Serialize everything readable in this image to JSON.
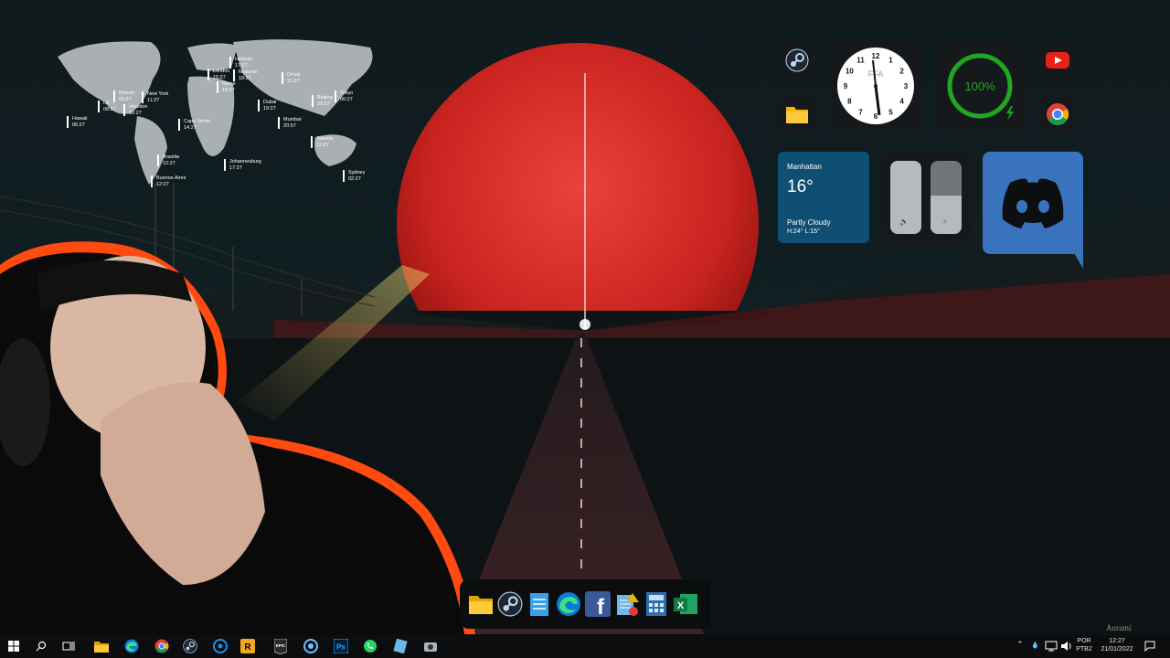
{
  "desktop": {
    "world_clock": {
      "cities": [
        {
          "name": "Hawaii",
          "time": "05:27"
        },
        {
          "name": "LA",
          "time": "08:27"
        },
        {
          "name": "Denver",
          "time": "09:27"
        },
        {
          "name": "Houston",
          "time": "10:27"
        },
        {
          "name": "New York",
          "time": "11:27"
        },
        {
          "name": "Cape Verde",
          "time": "14:27"
        },
        {
          "name": "Brasilia",
          "time": "12:27"
        },
        {
          "name": "Buenos Aires",
          "time": "12:27"
        },
        {
          "name": "London",
          "time": "15:27"
        },
        {
          "name": "Helsinki",
          "time": "17:27"
        },
        {
          "name": "Rome",
          "time": "16:27"
        },
        {
          "name": "Moscow",
          "time": "18:27"
        },
        {
          "name": "Omsk",
          "time": "21:27"
        },
        {
          "name": "Dubai",
          "time": "19:27"
        },
        {
          "name": "Mumbai",
          "time": "20:57"
        },
        {
          "name": "Johannesburg",
          "time": "17:27"
        },
        {
          "name": "Beijing",
          "time": "23:27"
        },
        {
          "name": "Tokyo",
          "time": "00:27"
        },
        {
          "name": "Jakarta",
          "time": "22:27"
        },
        {
          "name": "Sydney",
          "time": "02:27"
        }
      ]
    },
    "clock": {
      "brand": "FFA",
      "numbers": [
        "12",
        "1",
        "2",
        "3",
        "4",
        "5",
        "6",
        "7",
        "8",
        "9",
        "10",
        "11"
      ]
    },
    "battery": {
      "percent_label": "100%",
      "level": 1.0,
      "color": "#1fa81f"
    },
    "weather": {
      "city": "Manhattan",
      "temp": "16°",
      "condition": "Partly Cloudy",
      "hilo": "H:24° L:15°"
    },
    "shortcuts": [
      "steam-icon",
      "folder-icon",
      "youtube-icon",
      "chrome-icon",
      "discord-icon"
    ],
    "watermark": "Aurami"
  },
  "dock": {
    "items": [
      "file-explorer-icon",
      "steam-icon",
      "notepad-icon",
      "edge-icon",
      "facebook-icon",
      "notes-alert-icon",
      "calculator-icon",
      "excel-icon"
    ],
    "facebook_letter": "f",
    "excel_letter": "X"
  },
  "taskbar": {
    "apps": [
      "file-explorer",
      "edge",
      "chrome",
      "steam",
      "battle-net",
      "rockstar",
      "epic-games",
      "unknown-app",
      "photoshop",
      "whatsapp",
      "notepad",
      "camera"
    ],
    "epic_label": "EPIC",
    "ps_label": "Ps",
    "language": "POR",
    "layout": "PTB2",
    "time": "12:27",
    "date": "21/01/2022",
    "colors": {
      "bar": "#0c0d0e"
    }
  }
}
